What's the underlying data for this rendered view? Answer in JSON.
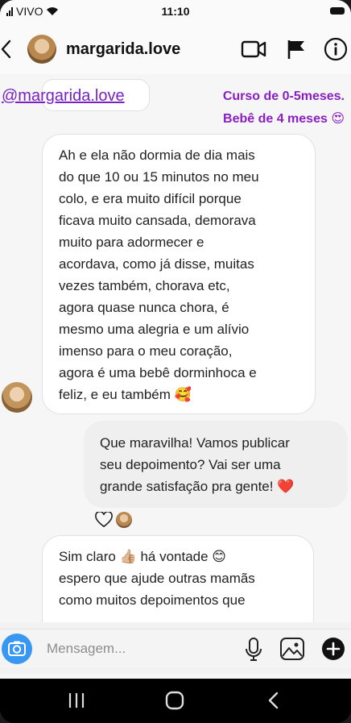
{
  "status_bar": {
    "carrier": "VIVO",
    "time": "11:10"
  },
  "header": {
    "username": "margarida.love",
    "icons": [
      "back-chevron-icon",
      "video-camera-icon",
      "flag-icon",
      "info-icon"
    ]
  },
  "story_reply": {
    "mention": "@margarida.love",
    "caption_line1": "Curso de 0-5meses.",
    "caption_line2": "Bebê de 4 meses 😍"
  },
  "messages": [
    {
      "direction": "incoming",
      "lines": [
        "Ah e ela não dormia de dia mais",
        "do que 10 ou 15 minutos no meu",
        "colo, e era muito difícil porque",
        "ficava muito cansada, demorava",
        "muito para adormecer e",
        "acordava, como já disse, muitas",
        "vezes também, chorava etc,",
        "agora quase nunca chora, é",
        "mesmo uma alegria e um alívio",
        "imenso para o meu coração,",
        "agora é uma bebê dorminhoca e",
        "feliz, e eu também 🥰"
      ]
    },
    {
      "direction": "outgoing",
      "lines": [
        "Que maravilha! Vamos publicar",
        "seu depoimento? Vai ser uma",
        "grande satisfação pra gente! ❤️"
      ]
    },
    {
      "direction": "incoming",
      "lines": [
        "Sim claro 👍🏼 há vontade 😊",
        "espero que ajude outras mamãs",
        "como muitos depoimentos que"
      ]
    }
  ],
  "composer": {
    "placeholder": "Mensagem..."
  },
  "colors": {
    "accent_blue": "#3897f0",
    "mention_purple": "#7a21c4",
    "heart_red": "#e0202a"
  }
}
